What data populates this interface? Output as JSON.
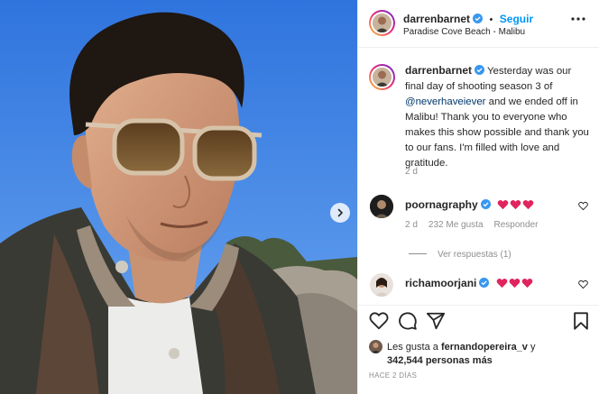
{
  "post": {
    "author": "darrenbarnet",
    "follow_label": "Seguir",
    "dot": "•",
    "location": "Paradise Cove Beach - Malibu",
    "caption_before": "Yesterday was our final day of shooting season 3 of ",
    "caption_mention": "@neverhaveiever",
    "caption_after": " and we ended off in Malibu! Thank you to everyone who makes this show possible and thank you to our fans. I'm filled with love and gratitude.",
    "caption_age": "2 d"
  },
  "comments": [
    {
      "user": "poornagraphy",
      "age": "2 d",
      "likes": "232 Me gusta",
      "reply_label": "Responder",
      "view_replies": "Ver respuestas (1)"
    },
    {
      "user": "richamoorjani"
    }
  ],
  "likes_summary": {
    "line1_prefix": "Les gusta a ",
    "line1_user": "fernandopereira_v",
    "line1_suffix": " y",
    "line2": "342,544 personas más"
  },
  "time_ago": "HACE 2 DÍAS",
  "icons": {
    "more": "more-icon",
    "heart": "heart-icon",
    "comment": "comment-icon",
    "share": "share-icon",
    "save": "bookmark-icon",
    "verified": "verified-badge-icon",
    "next": "chevron-right-icon"
  },
  "colors": {
    "follow": "#0095f6",
    "verified": "#3897f0",
    "emoji_heart": "#e0245e",
    "sky": "#3f86e8"
  }
}
